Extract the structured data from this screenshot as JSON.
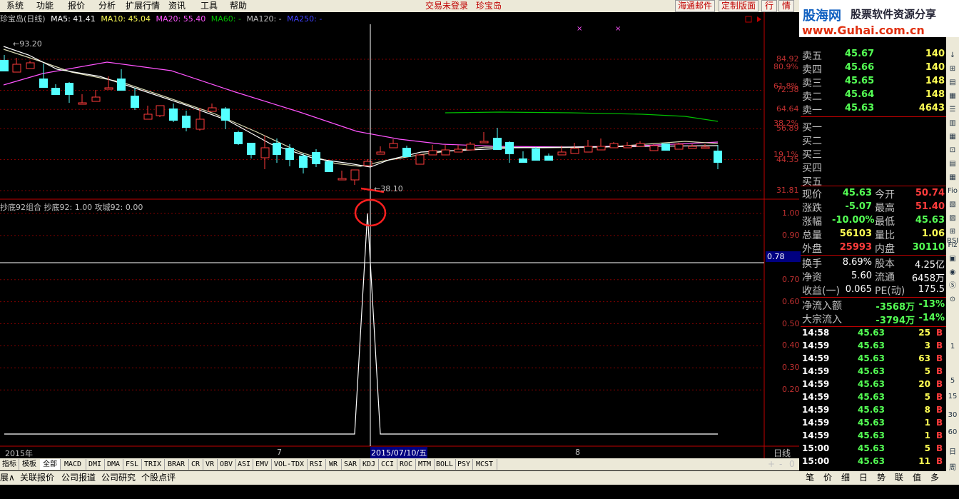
{
  "menu": [
    "系统",
    "功能",
    "报价",
    "分析",
    "扩展行情",
    "资讯",
    "工具",
    "帮助"
  ],
  "top_status": {
    "login": "交易未登录",
    "stock": "珍宝岛"
  },
  "top_buttons": [
    "海通邮件",
    "定制版面",
    "行",
    "情"
  ],
  "logo": {
    "title": "股海网",
    "slogan": "股票软件资源分享",
    "url": "www.Guhai.com.cn"
  },
  "kline": {
    "header_title": "珍宝岛(日线)",
    "ma5": "MA5: 41.41",
    "ma10": "MA10: 45.04",
    "ma20": "MA20: 55.40",
    "ma60": "MA60: -",
    "ma120": "MA120: -",
    "ma250": "MA250: -",
    "max_label": "93.20",
    "min_label": "38.10",
    "price_ticks": [
      "84.92",
      "72.38",
      "64.64",
      "56.89",
      "44.35",
      "31.81"
    ],
    "pct_ticks": [
      "80.9%",
      "61.8%",
      "38.2%",
      "19.1%"
    ],
    "date_labels": [
      "2015年",
      "7",
      "2015/07/10/五",
      "8"
    ],
    "period": "日线",
    "colors": {
      "up": "#ff3c3c",
      "down": "#54ffff",
      "ma5": "#ffffff",
      "ma10": "#ffff54",
      "ma20": "#ff54ff",
      "ma60": "#00c000"
    }
  },
  "indicator": {
    "header": "抄底92组合  抄底92: 1.00  攻城92: 0.00",
    "ticks": [
      "1.00",
      "0.90",
      "0.70",
      "0.60",
      "0.50",
      "0.40",
      "0.30",
      "0.20"
    ],
    "cursor_value": "0.78",
    "peak_value": 1.0
  },
  "quote": {
    "sells": [
      {
        "label": "卖五",
        "price": "45.67",
        "vol": "140"
      },
      {
        "label": "卖四",
        "price": "45.66",
        "vol": "140"
      },
      {
        "label": "卖三",
        "price": "45.65",
        "vol": "148"
      },
      {
        "label": "卖二",
        "price": "45.64",
        "vol": "148"
      },
      {
        "label": "卖一",
        "price": "45.63",
        "vol": "4643"
      }
    ],
    "buys": [
      {
        "label": "买一"
      },
      {
        "label": "买二"
      },
      {
        "label": "买三"
      },
      {
        "label": "买四"
      },
      {
        "label": "买五"
      }
    ],
    "stats": [
      {
        "l1": "现价",
        "v1": "45.63",
        "l2": "今开",
        "v2": "50.74"
      },
      {
        "l1": "涨跌",
        "v1": "-5.07",
        "l2": "最高",
        "v2": "51.40"
      },
      {
        "l1": "涨幅",
        "v1": "-10.00%",
        "l2": "最低",
        "v2": "45.63"
      },
      {
        "l1": "总量",
        "v1": "56103",
        "l2": "量比",
        "v2": "1.06"
      },
      {
        "l1": "外盘",
        "v1": "25993",
        "l2": "内盘",
        "v2": "30110"
      }
    ],
    "stats2": [
      {
        "l1": "换手",
        "v1": "8.69%",
        "l2": "股本",
        "v2": "4.25亿"
      },
      {
        "l1": "净资",
        "v1": "5.60",
        "l2": "流通",
        "v2": "6458万"
      },
      {
        "l1": "收益(一)",
        "v1": "0.065",
        "l2": "PE(动)",
        "v2": "175.5"
      }
    ],
    "flows": [
      {
        "label": "净流入额",
        "v": "-3568万",
        "p": "-13%"
      },
      {
        "label": "大宗流入",
        "v": "-3794万",
        "p": "-14%"
      }
    ],
    "ticks": [
      {
        "t": "14:58",
        "p": "45.63",
        "v": "25",
        "s": "B"
      },
      {
        "t": "14:59",
        "p": "45.63",
        "v": "3",
        "s": "B"
      },
      {
        "t": "14:59",
        "p": "45.63",
        "v": "63",
        "s": "B"
      },
      {
        "t": "14:59",
        "p": "45.63",
        "v": "5",
        "s": "B"
      },
      {
        "t": "14:59",
        "p": "45.63",
        "v": "20",
        "s": "B"
      },
      {
        "t": "14:59",
        "p": "45.63",
        "v": "5",
        "s": "B"
      },
      {
        "t": "14:59",
        "p": "45.63",
        "v": "8",
        "s": "B"
      },
      {
        "t": "14:59",
        "p": "45.63",
        "v": "1",
        "s": "B"
      },
      {
        "t": "14:59",
        "p": "45.63",
        "v": "1",
        "s": "B"
      },
      {
        "t": "15:00",
        "p": "45.63",
        "v": "5",
        "s": "B"
      },
      {
        "t": "15:00",
        "p": "45.63",
        "v": "11",
        "s": "B"
      }
    ]
  },
  "indicator_tabs": [
    "指标",
    "模板",
    "全部",
    "MACD",
    "DMI",
    "DMA",
    "FSL",
    "TRIX",
    "BRAR",
    "CR",
    "VR",
    "OBV",
    "ASI",
    "EMV",
    "VOL-TDX",
    "RSI",
    "WR",
    "SAR",
    "KDJ",
    "CCI",
    "ROC",
    "MTM",
    "BOLL",
    "PSY",
    "MCST"
  ],
  "zoom_controls": [
    "+",
    "-",
    "0"
  ],
  "status_tabs": [
    "展∧",
    "关联报价",
    "公司报道",
    "公司研究",
    "个股点评"
  ],
  "bottom_tabs": [
    "笔",
    "价",
    "细",
    "日",
    "势",
    "联",
    "值",
    "多"
  ],
  "side_tools": [
    "RSI",
    "1",
    "5",
    "15",
    "30",
    "60",
    "日",
    "周"
  ]
}
